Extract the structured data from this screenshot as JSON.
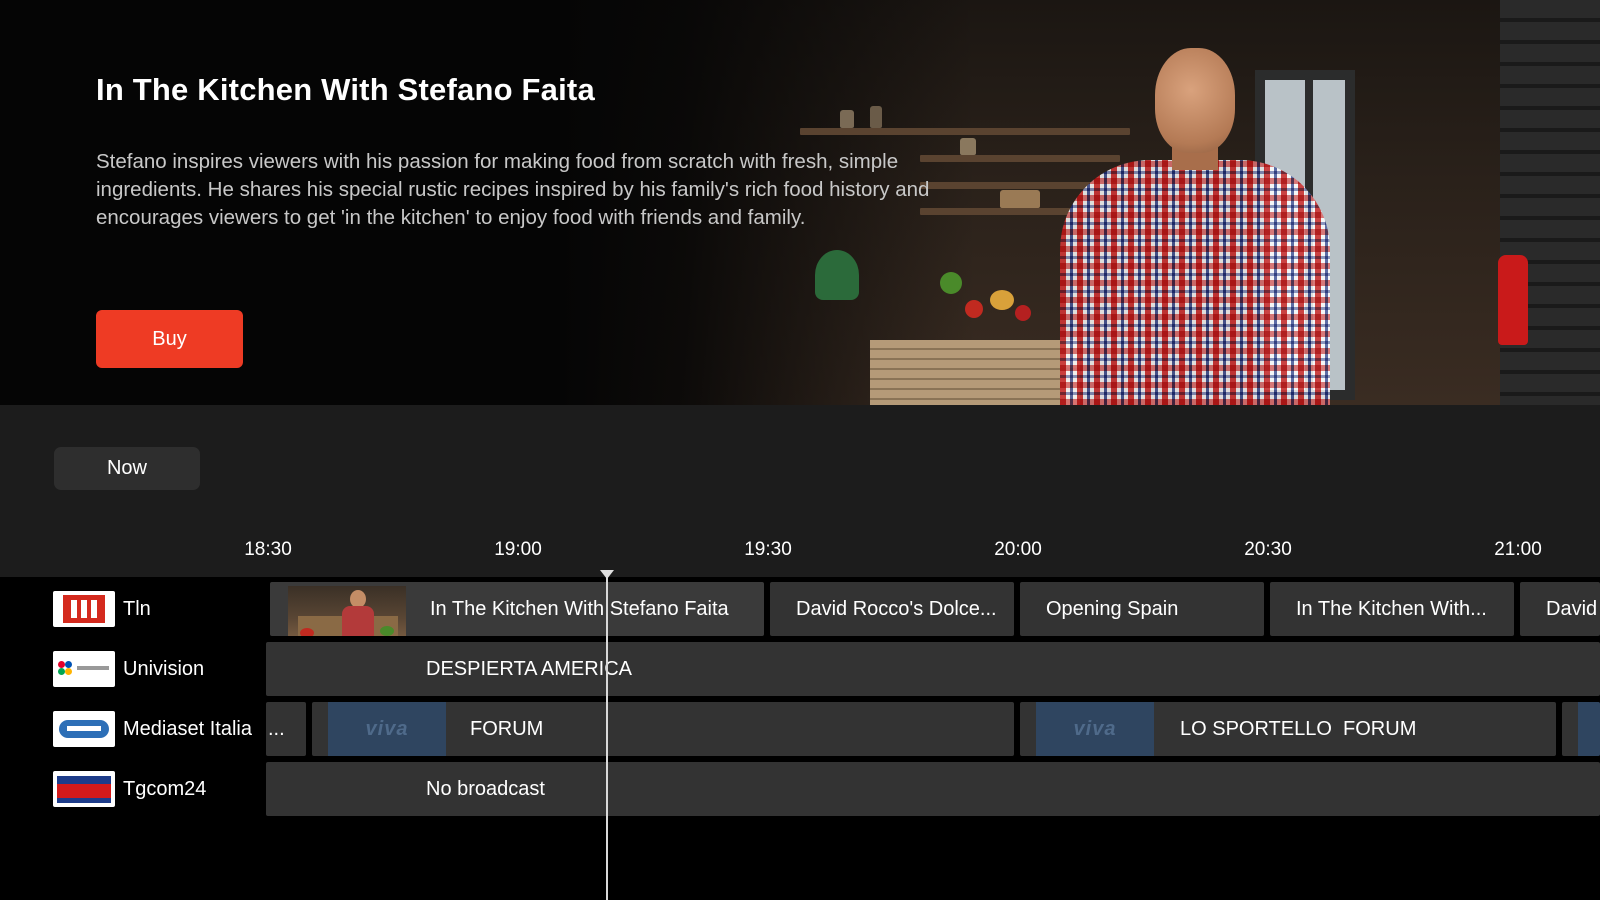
{
  "hero": {
    "title": "In The Kitchen With Stefano Faita",
    "description": "Stefano inspires viewers with his passion for making food from scratch with fresh, simple ingredients. He shares his special rustic recipes inspired by his family's rich food history and encourages viewers to get 'in the kitchen' to enjoy food with friends and family.",
    "buy_label": "Buy"
  },
  "guide": {
    "now_label": "Now",
    "times": [
      "18:30",
      "19:00",
      "19:30",
      "20:00",
      "20:30",
      "21:00"
    ],
    "channels": [
      {
        "name": "Tln",
        "logo": "tln-logo"
      },
      {
        "name": "Univision",
        "logo": "univision-logo"
      },
      {
        "name": "Mediaset Italia",
        "logo": "mediaset-logo"
      },
      {
        "name": "Tgcom24",
        "logo": "tgcom24-logo"
      }
    ],
    "rows": [
      [
        {
          "title": "In The Kitchen With Stefano Faita",
          "selected": true
        },
        {
          "title": "David Rocco's Dolce..."
        },
        {
          "title": "Opening Spain"
        },
        {
          "title": "In The Kitchen With..."
        },
        {
          "title": "David"
        }
      ],
      [
        {
          "title": "DESPIERTA AMERICA"
        }
      ],
      [
        {
          "title": "..."
        },
        {
          "title": "FORUM",
          "logo_text": "viva"
        },
        {
          "title": "LO SPORTELLO  FORUM",
          "logo_text": "viva"
        },
        {
          "title": ""
        }
      ],
      [
        {
          "title": "No broadcast"
        }
      ]
    ]
  },
  "colors": {
    "accent": "#ee3b24",
    "guide_bg": "#1c1c1c",
    "program_bg": "#333333",
    "viva_tile": "#2f4560"
  }
}
